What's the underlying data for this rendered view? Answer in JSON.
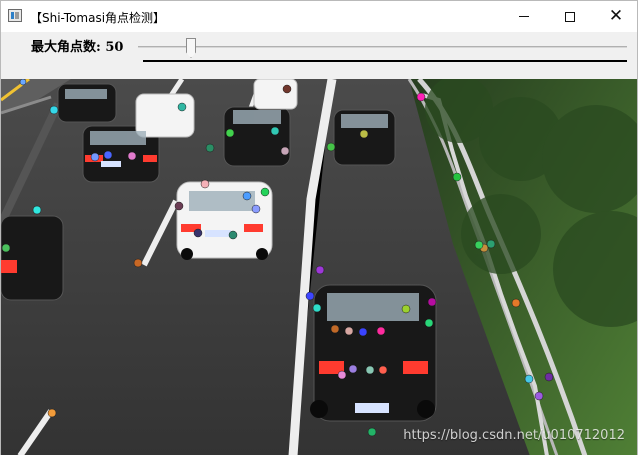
{
  "window": {
    "title": "【Shi-Tomasi角点检测】",
    "min_symbol": "—",
    "max_symbol": "□",
    "close_symbol": "✕"
  },
  "slider": {
    "label": "最大角点数: 50",
    "value": 50
  },
  "image": {
    "watermark": "https://blog.csdn.net/u010712012"
  }
}
